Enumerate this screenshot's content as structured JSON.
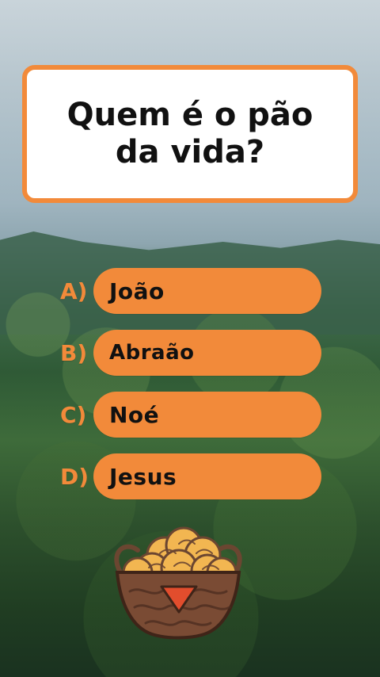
{
  "question": {
    "text": "Quem é o pão da vida?"
  },
  "answers": [
    {
      "letter": "A)",
      "label": "João"
    },
    {
      "letter": "B)",
      "label": "Abraão"
    },
    {
      "letter": "C)",
      "label": "Noé"
    },
    {
      "letter": "D)",
      "label": "Jesus"
    }
  ],
  "colors": {
    "accent": "#f28a3a",
    "question_bg": "#ffffff",
    "text": "#111111"
  },
  "icons": {
    "basket": "bread-basket-icon"
  }
}
